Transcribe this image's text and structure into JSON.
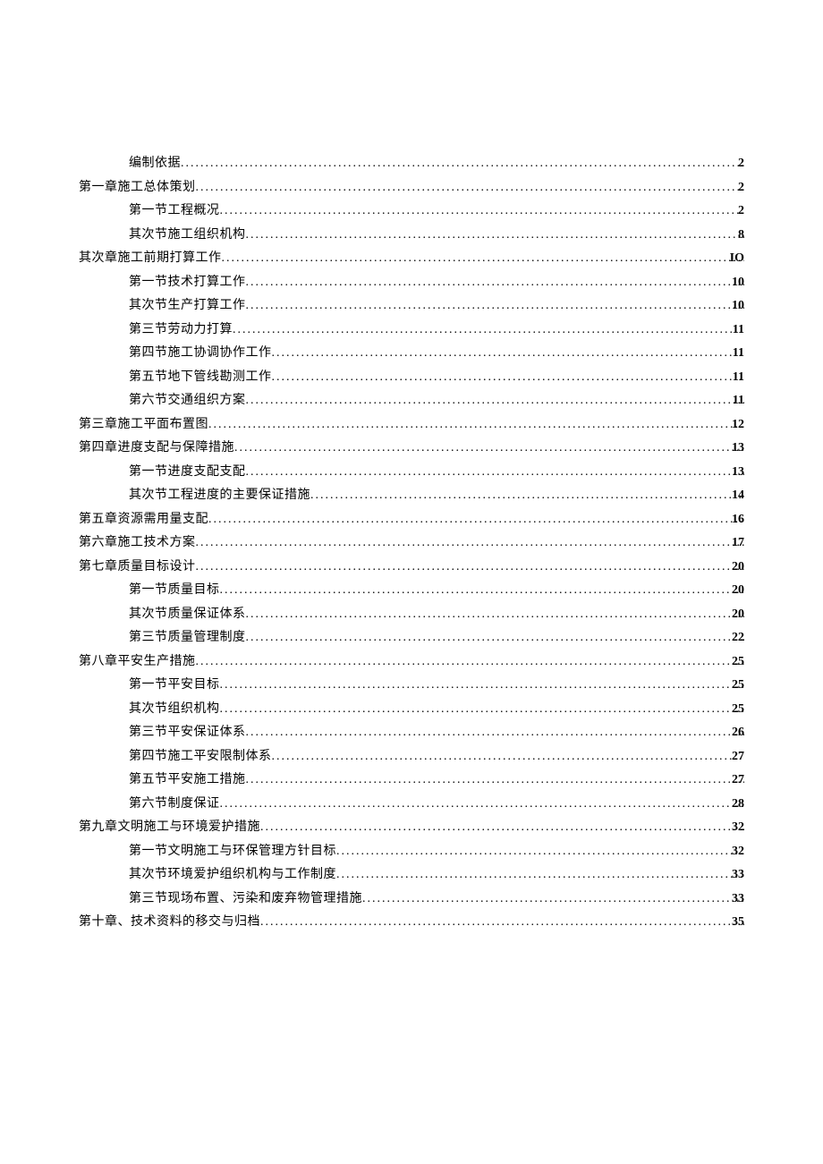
{
  "toc": [
    {
      "text": "编制依据",
      "page": "2",
      "indent": 1
    },
    {
      "text": "第一章施工总体策划",
      "page": "2",
      "indent": 0
    },
    {
      "text": "第一节工程概况",
      "page": "2",
      "indent": 1
    },
    {
      "text": "其次节施工组织机构",
      "page": "8",
      "indent": 1
    },
    {
      "text": "其次章施工前期打算工作",
      "page": "IO",
      "indent": 0
    },
    {
      "text": "第一节技术打算工作",
      "page": "10",
      "indent": 1
    },
    {
      "text": "其次节生产打算工作",
      "page": "10",
      "indent": 1
    },
    {
      "text": "第三节劳动力打算",
      "page": "11",
      "indent": 1
    },
    {
      "text": "第四节施工协调协作工作",
      "page": "11",
      "indent": 1
    },
    {
      "text": "第五节地下管线勘测工作",
      "page": "11",
      "indent": 1
    },
    {
      "text": "第六节交通组织方案",
      "page": "11",
      "indent": 1
    },
    {
      "text": "第三章施工平面布置图",
      "page": "12",
      "indent": 0
    },
    {
      "text": "第四章进度支配与保障措施",
      "page": "13",
      "indent": 0
    },
    {
      "text": "第一节进度支配支配",
      "page": "13",
      "indent": 1
    },
    {
      "text": "其次节工程进度的主要保证措施",
      "page": "14",
      "indent": 1
    },
    {
      "text": "第五章资源需用量支配",
      "page": "16",
      "indent": 0
    },
    {
      "text": "第六章施工技术方案",
      "page": "17",
      "indent": 0
    },
    {
      "text": "第七章质量目标设计",
      "page": "20",
      "indent": 0
    },
    {
      "text": "第一节质量目标",
      "page": "20",
      "indent": 1
    },
    {
      "text": "其次节质量保证体系",
      "page": "20",
      "indent": 1
    },
    {
      "text": "第三节质量管理制度",
      "page": "22",
      "indent": 1
    },
    {
      "text": "第八章平安生产措施",
      "page": "25",
      "indent": 0
    },
    {
      "text": "第一节平安目标",
      "page": "25",
      "indent": 1
    },
    {
      "text": "其次节组织机构",
      "page": "25",
      "indent": 1
    },
    {
      "text": "第三节平安保证体系",
      "page": "26",
      "indent": 1
    },
    {
      "text": "第四节施工平安限制体系",
      "page": "27",
      "indent": 1
    },
    {
      "text": "第五节平安施工措施",
      "page": "27",
      "indent": 1
    },
    {
      "text": "第六节制度保证",
      "page": "28",
      "indent": 1
    },
    {
      "text": "第九章文明施工与环境爱护措施",
      "page": "32",
      "indent": 0
    },
    {
      "text": "第一节文明施工与环保管理方针目标",
      "page": "32",
      "indent": 1
    },
    {
      "text": "其次节环境爱护组织机构与工作制度",
      "page": "33",
      "indent": 1
    },
    {
      "text": "第三节现场布置、污染和废弃物管理措施",
      "page": "33",
      "indent": 1
    },
    {
      "text": "第十章、技术资料的移交与归档",
      "page": "35",
      "indent": 0
    }
  ]
}
